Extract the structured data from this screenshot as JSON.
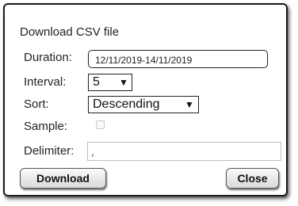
{
  "dialog": {
    "title": "Download CSV file",
    "duration": {
      "label": "Duration:",
      "value": "12/11/2019-14/11/2019"
    },
    "interval": {
      "label": "Interval:",
      "value": "5",
      "arrow": "▼"
    },
    "sort": {
      "label": "Sort:",
      "value": "Descending",
      "arrow": "▼"
    },
    "sample": {
      "label": "Sample:",
      "checked": false
    },
    "delimiter": {
      "label": "Delimiter:",
      "value": ","
    },
    "buttons": {
      "download": "Download",
      "close": "Close"
    }
  }
}
